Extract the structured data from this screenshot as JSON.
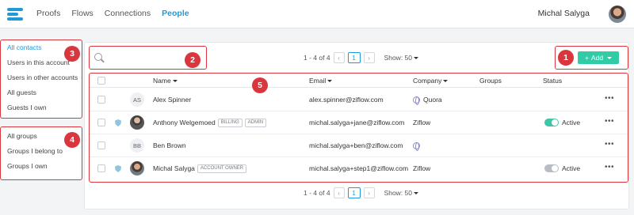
{
  "header": {
    "nav": [
      "Proofs",
      "Flows",
      "Connections",
      "People"
    ],
    "active_nav": "People",
    "username": "Michal Salyga"
  },
  "sidebar": {
    "contacts": [
      "All contacts",
      "Users in this account",
      "Users in other accounts",
      "All guests",
      "Guests I own"
    ],
    "groups": [
      "All groups",
      "Groups I belong to",
      "Groups I own"
    ]
  },
  "search": {
    "placeholder": ""
  },
  "pagination": {
    "range": "1 - 4 of 4",
    "page": "1",
    "show": "Show: 50"
  },
  "add_button": {
    "plus": "+",
    "label": "Add"
  },
  "table": {
    "headers": {
      "name": "Name",
      "email": "Email",
      "company": "Company",
      "groups": "Groups",
      "status": "Status"
    },
    "rows": [
      {
        "initials": "AS",
        "name": "Alex Spinner",
        "tags": [],
        "email": "alex.spinner@ziflow.com",
        "company": "Quora",
        "status": ""
      },
      {
        "initials": "",
        "name": "Anthony Welgemoed",
        "tags": [
          "BILLING",
          "ADMIN"
        ],
        "email": "michal.salyga+jane@ziflow.com",
        "company": "Ziflow",
        "status": "Active"
      },
      {
        "initials": "BB",
        "name": "Ben Brown",
        "tags": [],
        "email": "michal.salyga+ben@ziflow.com",
        "company": "",
        "status": ""
      },
      {
        "initials": "",
        "name": "Michal Salyga",
        "tags": [
          "ACCOUNT OWNER"
        ],
        "email": "michal.salyga+step1@ziflow.com",
        "company": "Ziflow",
        "status": "Active"
      }
    ]
  },
  "badges": [
    "1",
    "2",
    "3",
    "4",
    "5"
  ],
  "more_label": "•••",
  "colors": {
    "accent": "#1f9ad6",
    "add": "#2fcca6",
    "annotation": "#d9363e"
  }
}
